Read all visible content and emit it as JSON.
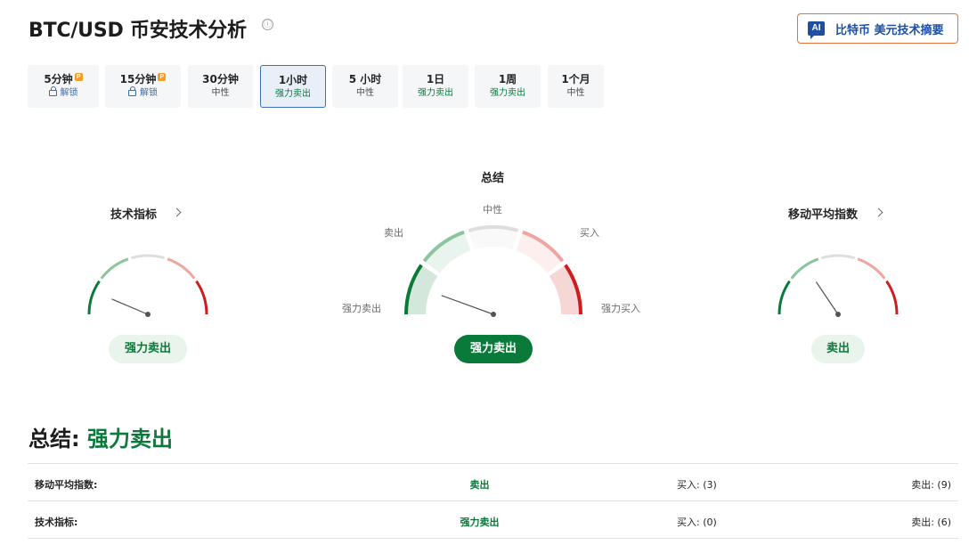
{
  "header": {
    "title": "BTC/USD 币安技术分析",
    "info_icon": "ⓘ",
    "ai_button": {
      "badge": "AI",
      "label": "比特币 美元技术摘要",
      "accent": "#e8713a"
    }
  },
  "tabs": [
    {
      "label": "5分钟",
      "sub": "解锁",
      "pro": true,
      "locked": true
    },
    {
      "label": "15分钟",
      "sub": "解锁",
      "pro": true,
      "locked": true
    },
    {
      "label": "30分钟",
      "sub": "中性"
    },
    {
      "label": "1小时",
      "sub": "强力卖出",
      "active": true
    },
    {
      "label": "5 小时",
      "sub": "中性"
    },
    {
      "label": "1日",
      "sub": "强力卖出"
    },
    {
      "label": "1周",
      "sub": "强力卖出"
    },
    {
      "label": "1个月",
      "sub": "中性"
    }
  ],
  "pro_badge": "P",
  "gauges": {
    "technical": {
      "title": "技术指标",
      "result": "强力卖出",
      "needle_angle_deg": 157
    },
    "summary": {
      "title": "总结",
      "result": "强力卖出",
      "needle_angle_deg": 160,
      "labels": {
        "neutral": "中性",
        "sell": "卖出",
        "buy": "买入",
        "strong_sell": "强力卖出",
        "strong_buy": "强力买入"
      }
    },
    "moving_averages": {
      "title": "移动平均指数",
      "result": "卖出",
      "needle_angle_deg": 124
    }
  },
  "summary": {
    "label": "总结:",
    "value": "强力卖出"
  },
  "table": [
    {
      "name": "移动平均指数:",
      "signal": "卖出",
      "buy": "买入: (3)",
      "sell": "卖出: (9)"
    },
    {
      "name": "技术指标:",
      "signal": "强力卖出",
      "buy": "买入: (0)",
      "sell": "卖出: (6)"
    }
  ],
  "colors": {
    "strong_sell": "#0a7a3a",
    "sell": "#8cc49f",
    "neutral": "#dcdee0",
    "buy": "#f0a6a0",
    "strong_buy": "#d01c1c",
    "active_tab_border": "#3b6fb6"
  }
}
